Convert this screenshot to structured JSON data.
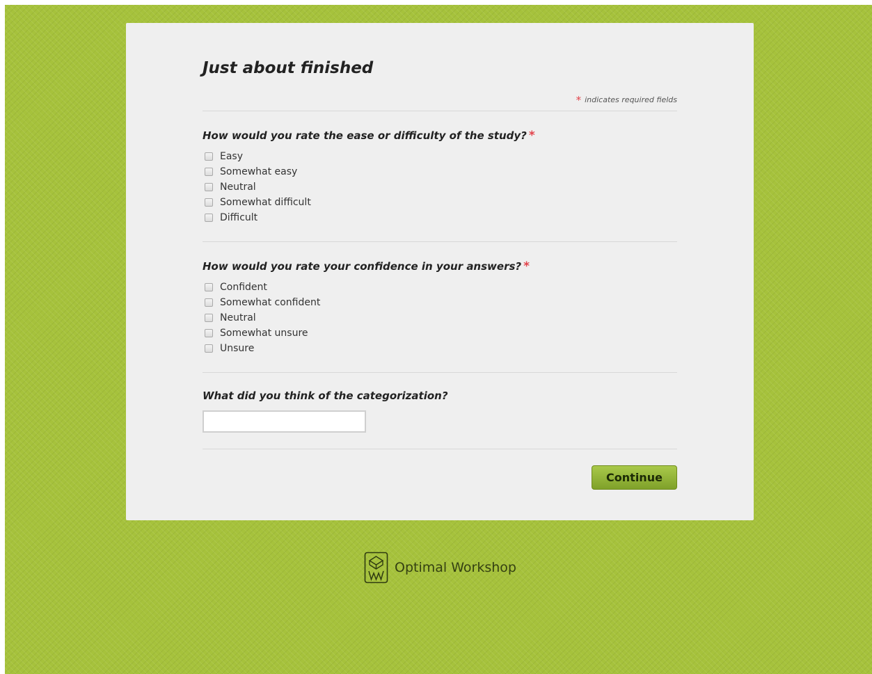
{
  "form": {
    "title": "Just about finished",
    "required_note": {
      "star": "*",
      "text": "indicates required fields"
    },
    "questions": [
      {
        "label": "How would you rate the ease or difficulty of the study?",
        "required_star": "*",
        "options": [
          "Easy",
          "Somewhat easy",
          "Neutral",
          "Somewhat difficult",
          "Difficult"
        ]
      },
      {
        "label": "How would you rate your confidence in your answers?",
        "required_star": "*",
        "options": [
          "Confident",
          "Somewhat confident",
          "Neutral",
          "Somewhat unsure",
          "Unsure"
        ]
      },
      {
        "label": "What did you think of the categorization?",
        "input_value": ""
      }
    ],
    "continue_label": "Continue"
  },
  "footer": {
    "logo_icon": "optimal-workshop-logo-icon",
    "brand": "Optimal Workshop"
  },
  "colors": {
    "background": "#a6c23c",
    "card": "#efefef",
    "required_star": "#e2434b",
    "button": "#8fb03a"
  }
}
